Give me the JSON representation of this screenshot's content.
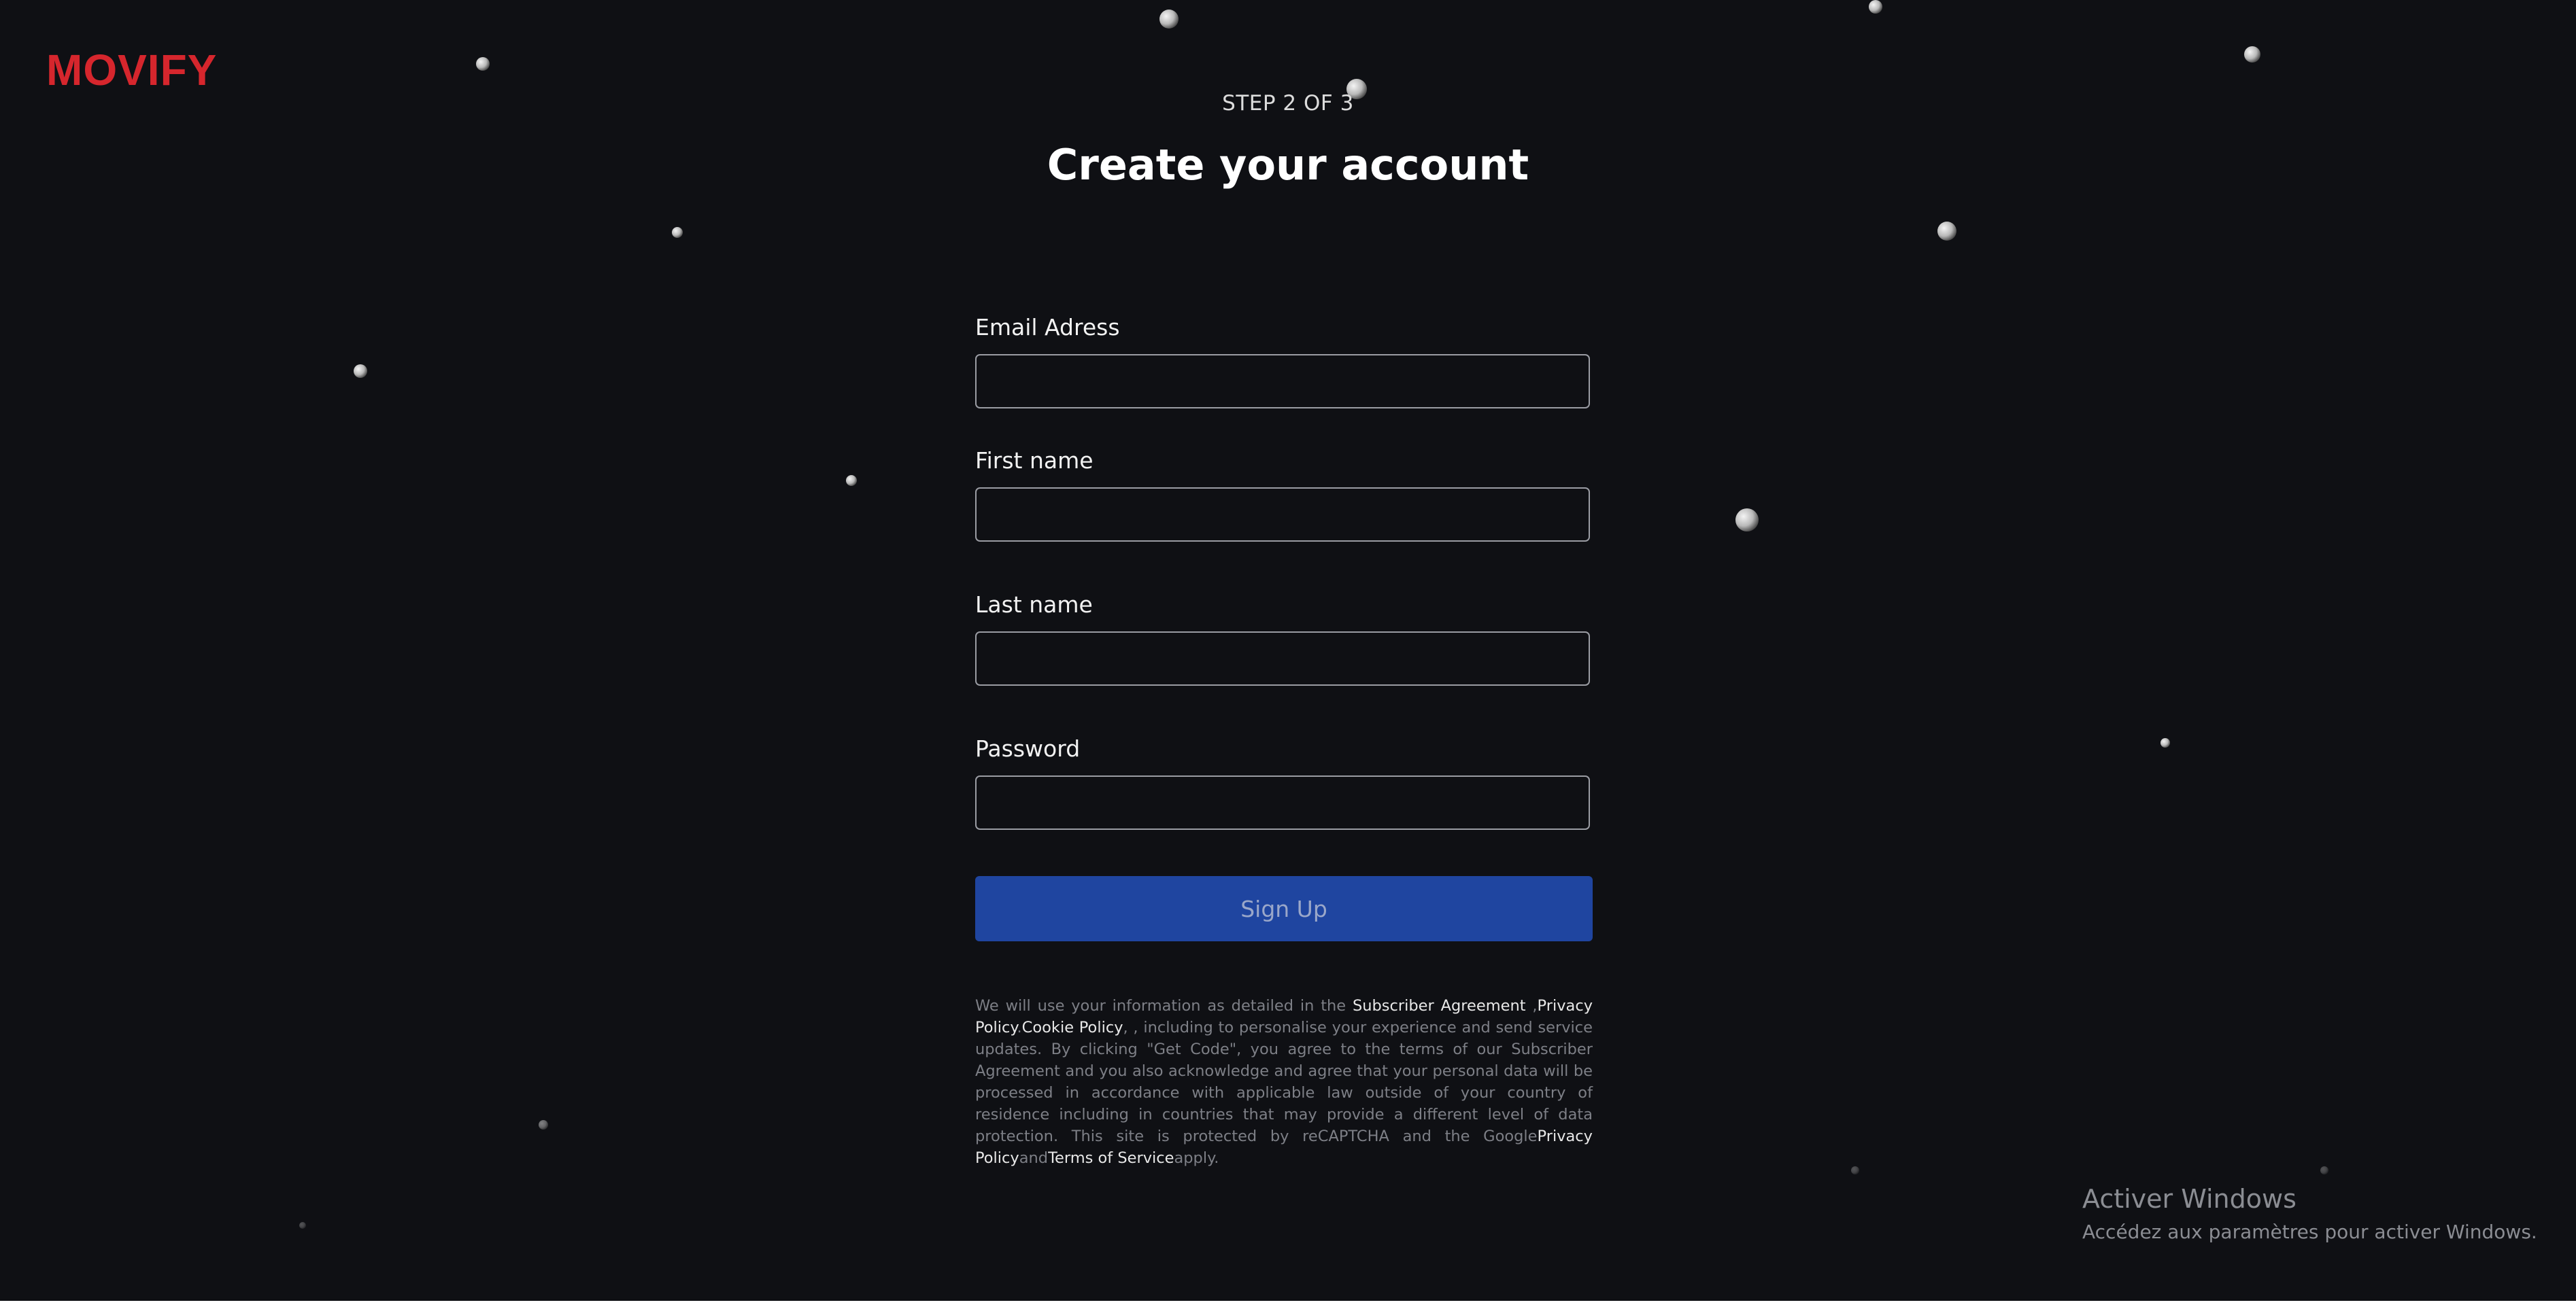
{
  "brand": {
    "logo": "MOVIFY",
    "accent_color": "#d6262d"
  },
  "header": {
    "step": "STEP 2 OF 3",
    "title": "Create your account"
  },
  "form": {
    "email": {
      "label": "Email Adress",
      "value": ""
    },
    "first_name": {
      "label": "First name",
      "value": ""
    },
    "last_name": {
      "label": "Last name",
      "value": ""
    },
    "password": {
      "label": "Password",
      "value": ""
    },
    "submit_label": "Sign Up",
    "submit_color": "#1f45a0"
  },
  "legal": {
    "part1": "We will use your information as detailed in the ",
    "link_subscriber": "Subscriber Agreement",
    "part2": " ,",
    "link_privacy": "Privacy Policy",
    "part3": ".",
    "link_cookie": "Cookie Policy",
    "part4": ", , including to personalise your experience and send service updates. By clicking \"Get Code\", you agree to the terms of our Subscriber Agreement and you also acknowledge and agree that your personal data will be processed in accordance with applicable law outside of your country of residence including in countries that may provide a different level of data protection. This site is protected by reCAPTCHA and the Google",
    "link_google_privacy": "Privacy Policy",
    "part5": "and",
    "link_terms": "Terms of Service",
    "part6": "apply."
  },
  "windows_watermark": {
    "title": "Activer Windows",
    "subtitle": "Accédez aux paramètres pour activer Windows."
  }
}
